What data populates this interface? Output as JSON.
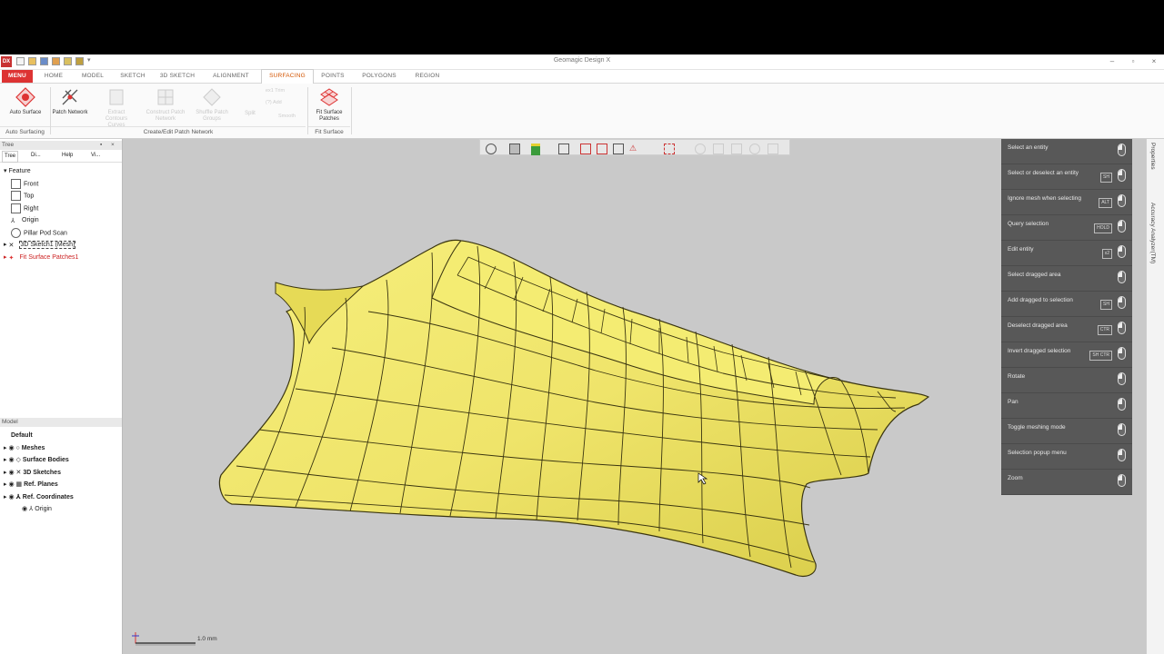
{
  "window": {
    "title": "Geomagic Design X",
    "logo": "DX",
    "min": "–",
    "max": "▫",
    "close": "×"
  },
  "ribbon_tabs": [
    "MENU",
    "HOME",
    "MODEL",
    "SKETCH",
    "3D SKETCH",
    "ALIGNMENT",
    "SURFACING",
    "POINTS",
    "POLYGONS",
    "REGION"
  ],
  "active_tab": "SURFACING",
  "ribbon": {
    "auto_surface": "Auto Surface",
    "patch_network": "Patch Network",
    "extract_contours": "Extract Contours Curves",
    "construct_patch_network": "Construct Patch Network",
    "shuffle_patch_groups": "Shuffle Patch Groups",
    "split": "Split",
    "ex_trim": "ex1 Trim",
    "ex_add": "(?) Add",
    "smooth": "Smooth",
    "fit_surface_patches": "Fit Surface Patches",
    "group_auto": "Auto Surfacing",
    "group_create": "Create/Edit Patch Network",
    "group_fit": "Fit Surface"
  },
  "tree_panel": {
    "title": "Tree",
    "tabs": [
      "Tree",
      "Di...",
      "Help",
      "Vi..."
    ],
    "section": "Feature",
    "items": [
      "Front",
      "Top",
      "Right",
      "Origin",
      "Pillar Pod Scan",
      "3D Sketch1 (Mesh)",
      "Fit Surface Patches1"
    ]
  },
  "model_panel": {
    "title": "Model",
    "root": "Default",
    "items": [
      "Meshes",
      "Surface Bodies",
      "3D Sketches",
      "Ref. Planes",
      "Ref. Coordinates",
      "Origin"
    ]
  },
  "mouse_help": [
    {
      "label": "Select an entity",
      "key": ""
    },
    {
      "label": "Select or deselect an entity",
      "key": "SH"
    },
    {
      "label": "Ignore mesh when selecting",
      "key": "ALT"
    },
    {
      "label": "Query selection",
      "key": "HOLD"
    },
    {
      "label": "Edit entity",
      "key": "x2"
    },
    {
      "label": "Select dragged area",
      "key": ""
    },
    {
      "label": "Add dragged to selection",
      "key": "SH"
    },
    {
      "label": "Deselect dragged area",
      "key": "CTR"
    },
    {
      "label": "Invert dragged selection",
      "key": "SH CTR"
    },
    {
      "label": "Rotate",
      "key": ""
    },
    {
      "label": "Pan",
      "key": ""
    },
    {
      "label": "Toggle meshing mode",
      "key": ""
    },
    {
      "label": "Selection popup menu",
      "key": ""
    },
    {
      "label": "Zoom",
      "key": ""
    }
  ],
  "right_tabs": [
    "Properties",
    "Accuracy Analyzer(TM)"
  ],
  "scale_label": "1.0 mm",
  "colors": {
    "surface": "#f4ec6e",
    "menu": "#d33333",
    "viewport": "#c9c9c9",
    "help_bg": "#585858"
  }
}
